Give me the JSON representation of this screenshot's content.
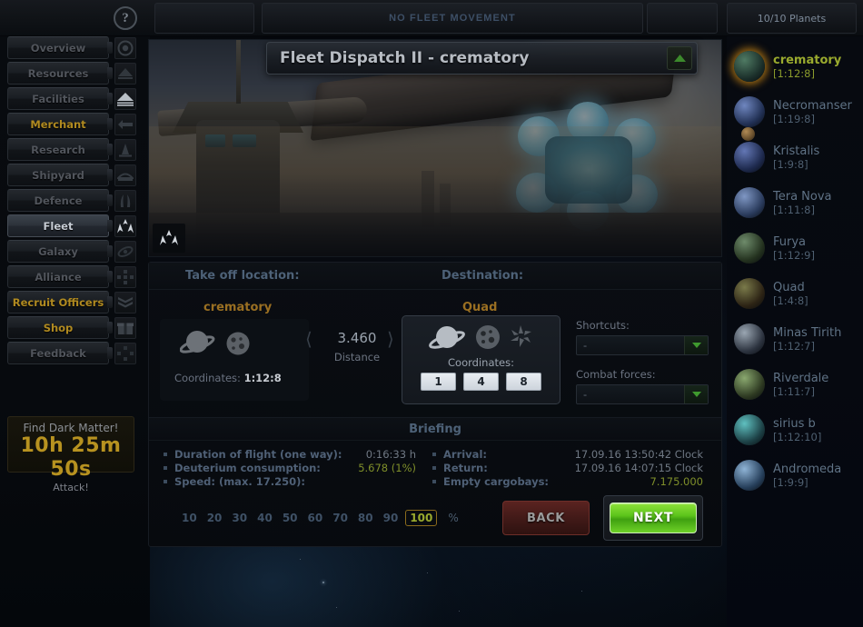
{
  "topbar": {
    "help_icon": "help-icon",
    "mail_icon": "mail-icon",
    "chat_icon": "chat-icon",
    "fleet_movement": "NO FLEET MOVEMENT",
    "planet_count": "10/10 Planets"
  },
  "sidebar": {
    "items": [
      {
        "label": "Overview",
        "state": "dim",
        "icon": "overview-icon"
      },
      {
        "label": "Resources",
        "state": "dim",
        "icon": "resources-icon"
      },
      {
        "label": "Facilities",
        "state": "dim",
        "icon": "facilities-icon"
      },
      {
        "label": "Merchant",
        "state": "gold",
        "icon": "merchant-icon"
      },
      {
        "label": "Research",
        "state": "dim",
        "icon": "research-icon"
      },
      {
        "label": "Shipyard",
        "state": "dim",
        "icon": "shipyard-icon"
      },
      {
        "label": "Defence",
        "state": "dim",
        "icon": "defence-icon"
      },
      {
        "label": "Fleet",
        "state": "active",
        "icon": "fleet-icon"
      },
      {
        "label": "Galaxy",
        "state": "dim",
        "icon": "galaxy-icon"
      },
      {
        "label": "Alliance",
        "state": "dim",
        "icon": "alliance-icon"
      },
      {
        "label": "Recruit Officers",
        "state": "gold",
        "icon": "officers-icon"
      },
      {
        "label": "Shop",
        "state": "gold",
        "icon": "shop-icon"
      },
      {
        "label": "Feedback",
        "state": "dim",
        "icon": "feedback-icon"
      }
    ],
    "dark_matter": {
      "title": "Find Dark Matter!",
      "timer": "10h 25m 50s",
      "subtitle": "Attack!",
      "timer_color": "#b79220"
    }
  },
  "planets": [
    {
      "name": "crematory",
      "coords": "[1:12:8]",
      "selected": true,
      "has_moon": false,
      "color_a": "#4f7a63",
      "color_b": "#1b2f2a"
    },
    {
      "name": "Necromanser",
      "coords": "[1:19:8]",
      "selected": false,
      "has_moon": true,
      "color_a": "#6f86bf",
      "color_b": "#223155"
    },
    {
      "name": "Kristalis",
      "coords": "[1:9:8]",
      "selected": false,
      "has_moon": false,
      "color_a": "#6377b5",
      "color_b": "#1e2a4e"
    },
    {
      "name": "Tera Nova",
      "coords": "[1:11:8]",
      "selected": false,
      "has_moon": false,
      "color_a": "#7f97c4",
      "color_b": "#2a3b5c"
    },
    {
      "name": "Furya",
      "coords": "[1:12:9]",
      "selected": false,
      "has_moon": false,
      "color_a": "#6e8b6b",
      "color_b": "#24321f"
    },
    {
      "name": "Quad",
      "coords": "[1:4:8]",
      "selected": false,
      "has_moon": false,
      "color_a": "#7a7a4a",
      "color_b": "#2d2415"
    },
    {
      "name": "Minas Tirith",
      "coords": "[1:12:7]",
      "selected": false,
      "has_moon": false,
      "color_a": "#9aa6b2",
      "color_b": "#2d3440"
    },
    {
      "name": "Riverdale",
      "coords": "[1:11:7]",
      "selected": false,
      "has_moon": false,
      "color_a": "#8aa86f",
      "color_b": "#2e3a22"
    },
    {
      "name": "sirius b",
      "coords": "[1:12:10]",
      "selected": false,
      "has_moon": false,
      "color_a": "#5fc0c0",
      "color_b": "#1d4146"
    },
    {
      "name": "Andromeda",
      "coords": "[1:9:9]",
      "selected": false,
      "has_moon": false,
      "color_a": "#8fb4d6",
      "color_b": "#27405c"
    }
  ],
  "dialog": {
    "title": "Fleet Dispatch II - crematory",
    "collapse_icon": "collapse-triangle-icon",
    "banner_badge_icon": "fleet-crest-icon",
    "takeoff": {
      "section_label": "Take off location:",
      "planet_name": "crematory",
      "coord_label": "Coordinates:",
      "coord_value": "1:12:8",
      "planet_icon": "planet-icon",
      "moon_icon": "moon-icon"
    },
    "distance": {
      "value": "3.460",
      "label": "Distance"
    },
    "destination": {
      "section_label": "Destination:",
      "planet_name": "Quad",
      "coord_label": "Coordinates:",
      "coords": [
        "1",
        "4",
        "8"
      ],
      "planet_icon": "planet-icon",
      "moon_icon": "moon-icon",
      "debris_icon": "debris-field-icon"
    },
    "selects": [
      {
        "label": "Shortcuts:",
        "value": "-",
        "arrow_icon": "chevron-down-icon"
      },
      {
        "label": "Combat forces:",
        "value": "-",
        "arrow_icon": "chevron-down-icon"
      }
    ],
    "briefing": {
      "title": "Briefing",
      "left": [
        {
          "label": "Duration of flight (one way):",
          "value": "0:16:33 h",
          "color": "grey"
        },
        {
          "label": "Deuterium consumption:",
          "value": "5.678 (1%)",
          "color": "green"
        },
        {
          "label": "Speed: (max. 17.250):",
          "value": "",
          "color": "grey"
        }
      ],
      "right": [
        {
          "label": "Arrival:",
          "value": "17.09.16 13:50:42 Clock",
          "color": "grey"
        },
        {
          "label": "Return:",
          "value": "17.09.16 14:07:15 Clock",
          "color": "grey"
        },
        {
          "label": "Empty cargobays:",
          "value": "7.175.000",
          "color": "green"
        }
      ]
    },
    "speeds": [
      "10",
      "20",
      "30",
      "40",
      "50",
      "60",
      "70",
      "80",
      "90",
      "100"
    ],
    "speed_selected": "100",
    "percent_sign": "%",
    "buttons": {
      "back": "BACK",
      "next": "NEXT",
      "next_color": "#5cc41b",
      "back_color": "#5a2320"
    }
  }
}
